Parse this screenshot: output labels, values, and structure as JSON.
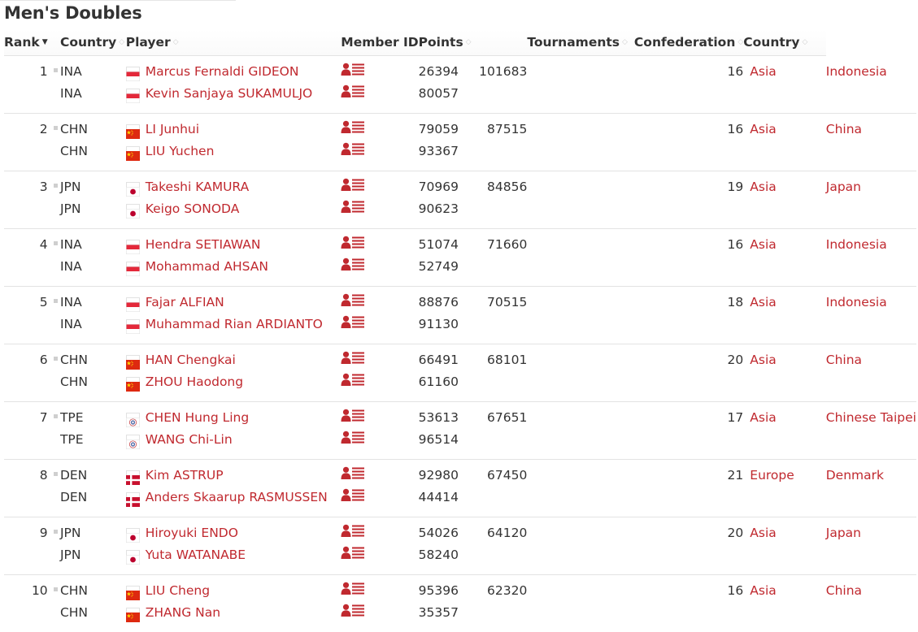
{
  "page": {
    "title": "Men's Doubles"
  },
  "columns": {
    "rank": "Rank",
    "country": "Country",
    "player": "Player",
    "member_id": "Member ID",
    "points": "Points",
    "tournaments": "Tournaments",
    "confederation": "Confederation",
    "country2": "Country"
  },
  "colors": {
    "link": "#c0292f",
    "text": "#333333",
    "border": "#e3e3e3"
  },
  "rankings": [
    {
      "rank": "1",
      "points": "101683",
      "tournaments": "16",
      "confederation": "Asia",
      "country_name": "Indonesia",
      "players": [
        {
          "code": "INA",
          "flag": "INA",
          "name": "Marcus Fernaldi GIDEON",
          "member_id": "26394"
        },
        {
          "code": "INA",
          "flag": "INA",
          "name": "Kevin Sanjaya SUKAMULJO",
          "member_id": "80057"
        }
      ]
    },
    {
      "rank": "2",
      "points": "87515",
      "tournaments": "16",
      "confederation": "Asia",
      "country_name": "China",
      "players": [
        {
          "code": "CHN",
          "flag": "CHN",
          "name": "LI Junhui",
          "member_id": "79059"
        },
        {
          "code": "CHN",
          "flag": "CHN",
          "name": "LIU Yuchen",
          "member_id": "93367"
        }
      ]
    },
    {
      "rank": "3",
      "points": "84856",
      "tournaments": "19",
      "confederation": "Asia",
      "country_name": "Japan",
      "players": [
        {
          "code": "JPN",
          "flag": "JPN",
          "name": "Takeshi KAMURA",
          "member_id": "70969"
        },
        {
          "code": "JPN",
          "flag": "JPN",
          "name": "Keigo SONODA",
          "member_id": "90623"
        }
      ]
    },
    {
      "rank": "4",
      "points": "71660",
      "tournaments": "16",
      "confederation": "Asia",
      "country_name": "Indonesia",
      "players": [
        {
          "code": "INA",
          "flag": "INA",
          "name": "Hendra SETIAWAN",
          "member_id": "51074"
        },
        {
          "code": "INA",
          "flag": "INA",
          "name": "Mohammad AHSAN",
          "member_id": "52749"
        }
      ]
    },
    {
      "rank": "5",
      "points": "70515",
      "tournaments": "18",
      "confederation": "Asia",
      "country_name": "Indonesia",
      "players": [
        {
          "code": "INA",
          "flag": "INA",
          "name": "Fajar ALFIAN",
          "member_id": "88876"
        },
        {
          "code": "INA",
          "flag": "INA",
          "name": "Muhammad Rian ARDIANTO",
          "member_id": "91130"
        }
      ]
    },
    {
      "rank": "6",
      "points": "68101",
      "tournaments": "20",
      "confederation": "Asia",
      "country_name": "China",
      "players": [
        {
          "code": "CHN",
          "flag": "CHN",
          "name": "HAN Chengkai",
          "member_id": "66491"
        },
        {
          "code": "CHN",
          "flag": "CHN",
          "name": "ZHOU Haodong",
          "member_id": "61160"
        }
      ]
    },
    {
      "rank": "7",
      "points": "67651",
      "tournaments": "17",
      "confederation": "Asia",
      "country_name": "Chinese Taipei",
      "players": [
        {
          "code": "TPE",
          "flag": "TPE",
          "name": "CHEN Hung Ling",
          "member_id": "53613"
        },
        {
          "code": "TPE",
          "flag": "TPE",
          "name": "WANG Chi-Lin",
          "member_id": "96514"
        }
      ]
    },
    {
      "rank": "8",
      "points": "67450",
      "tournaments": "21",
      "confederation": "Europe",
      "country_name": "Denmark",
      "players": [
        {
          "code": "DEN",
          "flag": "DEN",
          "name": "Kim ASTRUP",
          "member_id": "92980"
        },
        {
          "code": "DEN",
          "flag": "DEN",
          "name": "Anders Skaarup RASMUSSEN",
          "member_id": "44414"
        }
      ]
    },
    {
      "rank": "9",
      "points": "64120",
      "tournaments": "20",
      "confederation": "Asia",
      "country_name": "Japan",
      "players": [
        {
          "code": "JPN",
          "flag": "JPN",
          "name": "Hiroyuki ENDO",
          "member_id": "54026"
        },
        {
          "code": "JPN",
          "flag": "JPN",
          "name": "Yuta WATANABE",
          "member_id": "58240"
        }
      ]
    },
    {
      "rank": "10",
      "points": "62320",
      "tournaments": "16",
      "confederation": "Asia",
      "country_name": "China",
      "players": [
        {
          "code": "CHN",
          "flag": "CHN",
          "name": "LIU Cheng",
          "member_id": "95396"
        },
        {
          "code": "CHN",
          "flag": "CHN",
          "name": "ZHANG Nan",
          "member_id": "35357"
        }
      ]
    }
  ]
}
